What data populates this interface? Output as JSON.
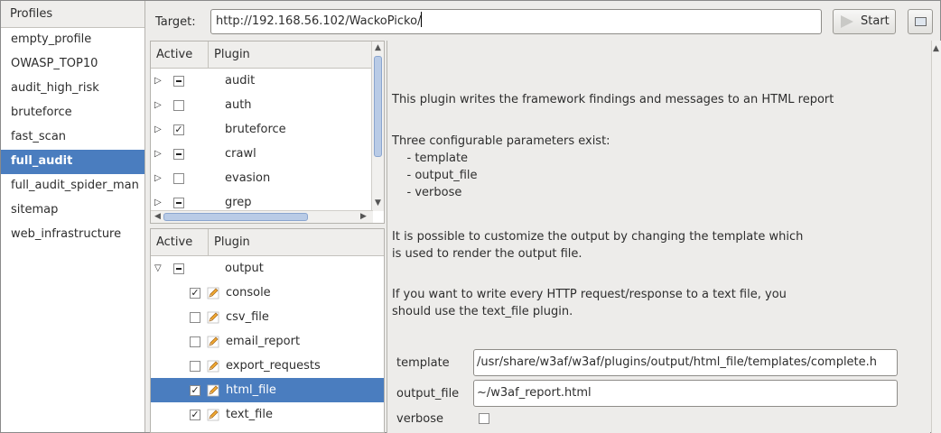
{
  "profiles": {
    "header": "Profiles",
    "items": [
      "empty_profile",
      "OWASP_TOP10",
      "audit_high_risk",
      "bruteforce",
      "fast_scan",
      "full_audit",
      "full_audit_spider_man",
      "sitemap",
      "web_infrastructure"
    ],
    "selected": "full_audit"
  },
  "toolbar": {
    "target_label": "Target:",
    "target_value": "http://192.168.56.102/WackoPicko/",
    "start_label": "Start"
  },
  "plugins_top": {
    "col_active": "Active",
    "col_plugin": "Plugin",
    "rows": [
      {
        "expander": "▷",
        "state": "partial",
        "name": "audit"
      },
      {
        "expander": "▷",
        "state": "unchecked",
        "name": "auth"
      },
      {
        "expander": "▷",
        "state": "checked",
        "name": "bruteforce"
      },
      {
        "expander": "▷",
        "state": "partial",
        "name": "crawl"
      },
      {
        "expander": "▷",
        "state": "unchecked",
        "name": "evasion"
      },
      {
        "expander": "▷",
        "state": "partial",
        "name": "grep"
      }
    ]
  },
  "plugins_bottom": {
    "col_active": "Active",
    "col_plugin": "Plugin",
    "group": {
      "expander": "▽",
      "state": "partial",
      "name": "output"
    },
    "children": [
      {
        "checked": true,
        "name": "console"
      },
      {
        "checked": false,
        "name": "csv_file"
      },
      {
        "checked": false,
        "name": "email_report"
      },
      {
        "checked": false,
        "name": "export_requests"
      },
      {
        "checked": true,
        "name": "html_file"
      },
      {
        "checked": true,
        "name": "text_file"
      }
    ],
    "selected": "html_file"
  },
  "description": {
    "line1": "This plugin writes the framework findings and messages to an HTML report",
    "line2": "Three configurable parameters exist:",
    "param1": "    - template",
    "param2": "    - output_file",
    "param3": "    - verbose",
    "line3": "It is possible to customize the output by changing the template which",
    "line4": "is used to render the output file.",
    "line5": "If you want to write every HTTP request/response to a text file, you",
    "line6": "should use the text_file plugin."
  },
  "config": {
    "template_label": "template",
    "template_value": "/usr/share/w3af/w3af/plugins/output/html_file/templates/complete.h",
    "output_file_label": "output_file",
    "output_file_value": "~/w3af_report.html",
    "verbose_label": "verbose",
    "verbose_checked": false
  }
}
